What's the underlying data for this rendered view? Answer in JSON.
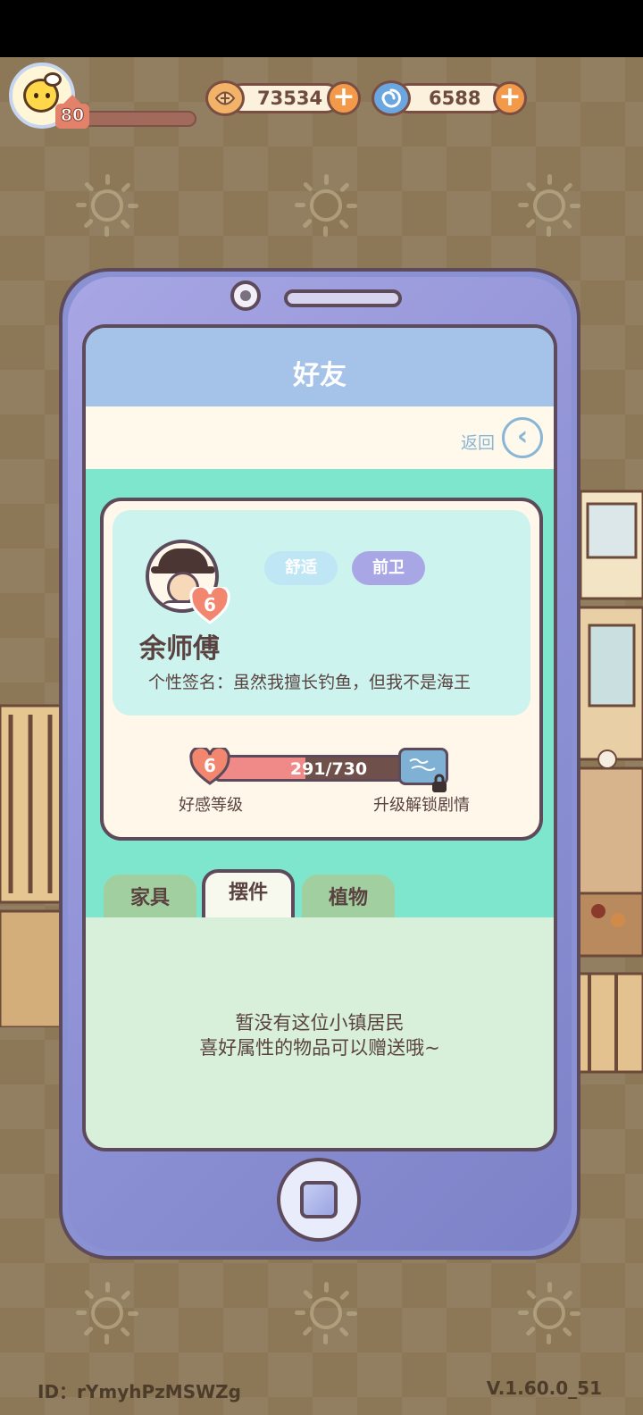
{
  "player": {
    "level": "80",
    "xp_fraction": 0.0
  },
  "currencies": [
    {
      "icon": "coin-icon",
      "value": "73534"
    },
    {
      "icon": "swirl-gem-icon",
      "value": "6588"
    }
  ],
  "screen": {
    "title": "好友",
    "back_label": "返回"
  },
  "npc": {
    "name": "余师傅",
    "affinity_level": "6",
    "tags": [
      "舒适",
      "前卫"
    ],
    "signature_label": "个性签名：",
    "signature_text": "虽然我擅长钓鱼，但我不是海王"
  },
  "affinity": {
    "level": "6",
    "progress_text": "291/730",
    "current": 291,
    "max": 730,
    "label": "好感等级",
    "unlock_label": "升级解锁剧情"
  },
  "tabs": [
    {
      "label": "家具",
      "active": false
    },
    {
      "label": "摆件",
      "active": true
    },
    {
      "label": "植物",
      "active": false
    }
  ],
  "empty_message": {
    "line1": "暂没有这位小镇居民",
    "line2": "喜好属性的物品可以赠送哦~"
  },
  "footer": {
    "id_text": "ID：rYmyhPzMSWZg",
    "version": "V.1.60.0_51"
  },
  "colors": {
    "tag_comfort": "#bfe6f5",
    "tag_avant": "#a9a6e6",
    "heart": "#f2866f"
  }
}
